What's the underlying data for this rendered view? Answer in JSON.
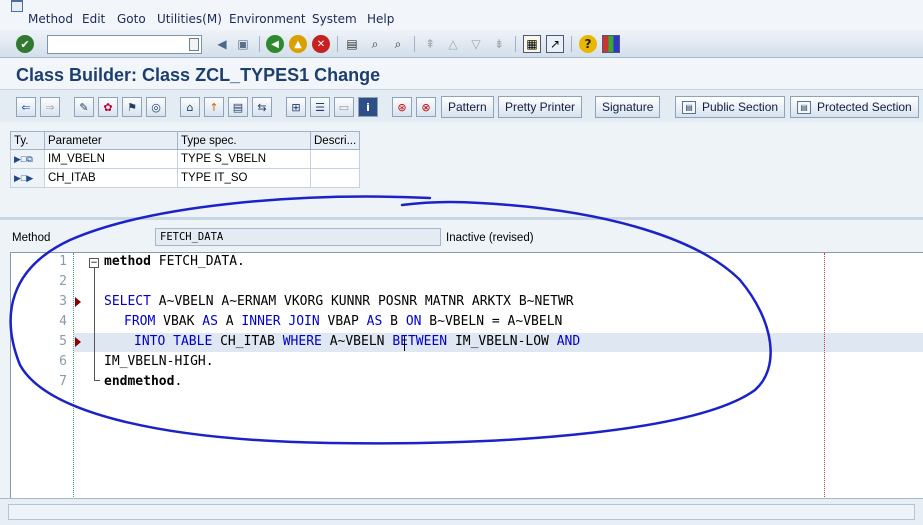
{
  "menu": [
    "Method",
    "Edit",
    "Goto",
    "Utilities(M)",
    "Environment",
    "System",
    "Help"
  ],
  "icons": {
    "app": "window-icon",
    "enter": "check-icon",
    "save": "save-icon",
    "back": "back-icon",
    "exit": "exit-icon",
    "cancel": "cancel-icon",
    "print": "print-icon",
    "find": "find-icon",
    "find_next": "find-next-icon",
    "help": "help-icon"
  },
  "title": "Class Builder: Class ZCL_TYPES1 Change",
  "toolbar_buttons": [
    "Pattern",
    "Pretty Printer",
    "Signature",
    "Public Section",
    "Protected Section"
  ],
  "params": {
    "headers": [
      "Ty.",
      "Parameter",
      "Type spec.",
      "Descri..."
    ],
    "rows": [
      {
        "parameter": "IM_VBELN",
        "type_spec": "TYPE S_VBELN",
        "description": ""
      },
      {
        "parameter": "CH_ITAB",
        "type_spec": "TYPE IT_SO",
        "description": ""
      }
    ]
  },
  "method_bar": {
    "label": "Method",
    "value": "FETCH_DATA",
    "status": "Inactive (revised)"
  },
  "code": {
    "line_numbers": [
      "1",
      "2",
      "3",
      "4",
      "5",
      "6",
      "7"
    ],
    "l1_kw": "method",
    "l1_rest": " FETCH_DATA.",
    "l3_a": "SELECT",
    "l3_b": " A~VBELN A~ERNAM VKORG KUNNR POSNR MATNR ARKTX B~NETWR",
    "l4_a": "FROM",
    "l4_b": " VBAK ",
    "l4_c": "AS",
    "l4_d": " A ",
    "l4_e": "INNER JOIN",
    "l4_f": " VBAP ",
    "l4_g": "AS",
    "l4_h": " B ",
    "l4_i": "ON",
    "l4_j": " B~VBELN = A~VBELN",
    "l5_a": "INTO TABLE",
    "l5_b": " CH_ITAB ",
    "l5_c": "WHERE",
    "l5_d": " A~VBELN ",
    "l5_e": "BETWEEN",
    "l5_f": " IM_VBELN-LOW ",
    "l5_g": "AND",
    "l6": "IM_VBELN-HIGH.",
    "l7_kw": "endmethod",
    "l7_rest": "."
  },
  "colors": {
    "keyword": "#0000cc",
    "title": "#1d3f6e",
    "annotation": "#1a22c8"
  }
}
